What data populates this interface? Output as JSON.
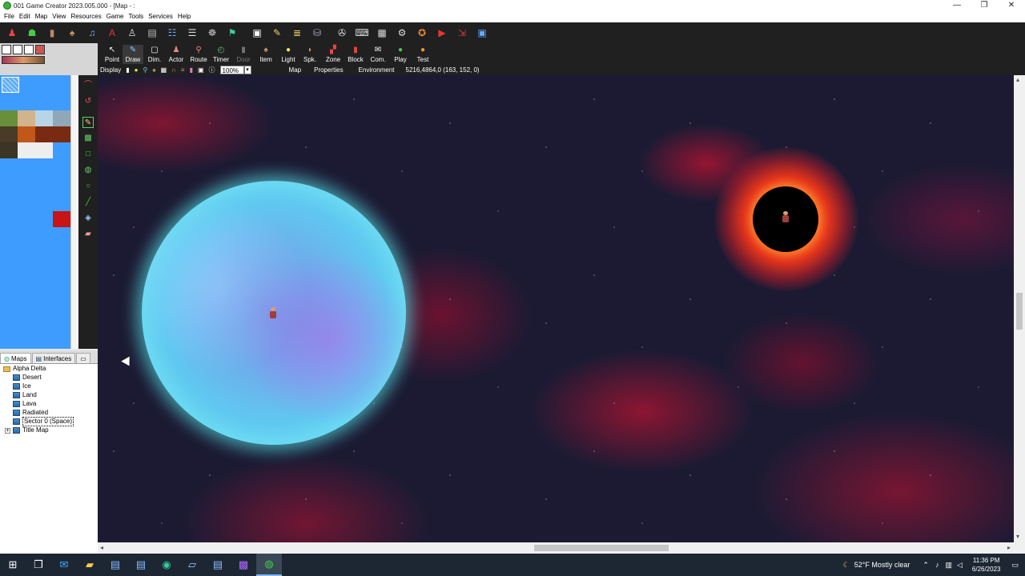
{
  "window": {
    "title": "001 Game Creator 2023.005.000 - [Map - :",
    "controls": [
      "—",
      "❐",
      "✕"
    ]
  },
  "menu": [
    "File",
    "Edit",
    "Map",
    "View",
    "Resources",
    "Game",
    "Tools",
    "Services",
    "Help"
  ],
  "map_tools": [
    {
      "label": "Point",
      "icon": "pointer-icon"
    },
    {
      "label": "Draw",
      "icon": "pencil-icon"
    },
    {
      "label": "Dim.",
      "icon": "dim-icon"
    },
    {
      "label": "Actor",
      "icon": "actor-icon"
    },
    {
      "label": "Route",
      "icon": "route-icon"
    },
    {
      "label": "Timer",
      "icon": "timer-icon"
    },
    {
      "label": "Door",
      "icon": "door-icon"
    },
    {
      "label": "Item",
      "icon": "item-icon"
    },
    {
      "label": "Light",
      "icon": "light-icon"
    },
    {
      "label": "Spk.",
      "icon": "speaker-icon"
    },
    {
      "label": "Zone",
      "icon": "zone-icon"
    },
    {
      "label": "Block",
      "icon": "block-icon"
    },
    {
      "label": "Com.",
      "icon": "comment-icon"
    },
    {
      "label": "Play",
      "icon": "play-icon"
    },
    {
      "label": "Test",
      "icon": "test-icon"
    }
  ],
  "display_bar": {
    "display_label": "Display",
    "zoom": "100%",
    "map_tab": "Map",
    "properties_tab": "Properties",
    "environment_tab": "Environment",
    "coords": "5216,4864,0 (163, 152, 0)"
  },
  "panel_tabs": {
    "maps": "Maps",
    "interfaces": "Interfaces"
  },
  "tree": {
    "root": "Alpha Delta",
    "children": [
      "Desert",
      "Ice",
      "Land",
      "Lava",
      "Radiated",
      "Sector 0 (Space)"
    ],
    "selected": "Sector 0 (Space)",
    "title_map": "Title Map"
  },
  "tray": {
    "weather": "52°F  Mostly clear",
    "time": "11:36 PM",
    "date": "6/26/2023"
  },
  "colors": {
    "toolbar_bg": "#202020",
    "tileset_bg": "#3f9cff",
    "space_bg": "#1c1a33",
    "star_cyan": "#7ff4f6"
  }
}
